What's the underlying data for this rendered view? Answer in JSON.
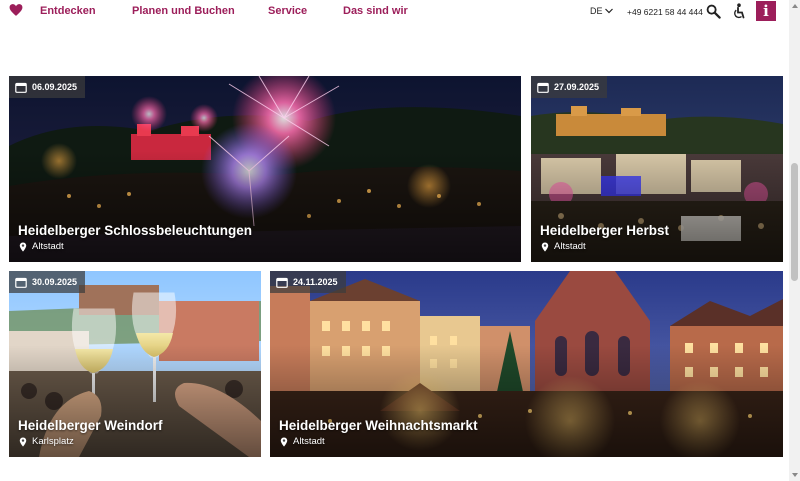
{
  "header": {
    "logo": "heart-logo-icon",
    "nav": [
      {
        "label": "Entdecken"
      },
      {
        "label": "Planen und Buchen"
      },
      {
        "label": "Service"
      },
      {
        "label": "Das sind wir"
      }
    ],
    "language": "DE",
    "phone": "+49 6221 58 44 444",
    "icons": [
      "search-icon",
      "accessibility-icon",
      "info-icon"
    ],
    "info_label": "i"
  },
  "colors": {
    "brand": "#9c1e5a",
    "badge_bg": "#3c3c3c",
    "text_on_image": "#ffffff"
  },
  "events": [
    {
      "date": "06.09.2025",
      "title": "Heidelberger Schlossbeleuchtungen",
      "location": "Altstadt"
    },
    {
      "date": "27.09.2025",
      "title": "Heidelberger Herbst",
      "location": "Altstadt"
    },
    {
      "date": "30.09.2025",
      "title": "Heidelberger Weindorf",
      "location": "Karlsplatz"
    },
    {
      "date": "24.11.2025",
      "title": "Heidelberger Weihnachtsmarkt",
      "location": "Altstadt"
    }
  ]
}
